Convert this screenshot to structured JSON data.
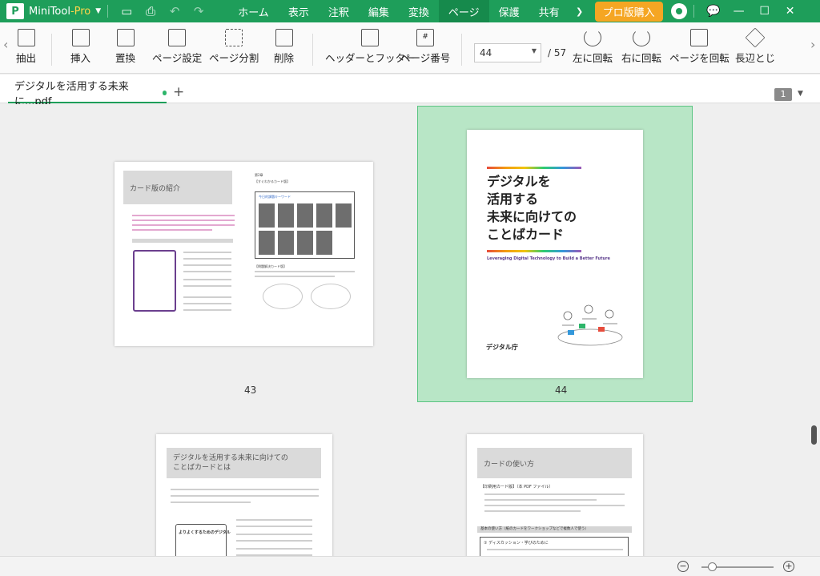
{
  "app": {
    "name": "MiniTool",
    "name_suffix": "-Pro",
    "logo_text": "P"
  },
  "menu": {
    "items": [
      {
        "label": "ホーム"
      },
      {
        "label": "表示"
      },
      {
        "label": "注釈"
      },
      {
        "label": "編集"
      },
      {
        "label": "変換"
      },
      {
        "label": "ページ",
        "active": true
      },
      {
        "label": "保護"
      },
      {
        "label": "共有"
      }
    ],
    "buy_label": "プロ版購入"
  },
  "ribbon": {
    "buttons": [
      {
        "label": "抽出",
        "icon": "extract-icon"
      },
      {
        "label": "挿入",
        "icon": "insert-page-icon"
      },
      {
        "label": "置換",
        "icon": "replace-page-icon"
      },
      {
        "label": "ページ設定",
        "icon": "page-setup-icon"
      },
      {
        "label": "ページ分割",
        "icon": "split-page-icon"
      },
      {
        "label": "削除",
        "icon": "delete-page-icon"
      },
      {
        "label": "ヘッダーとフッター",
        "icon": "header-footer-icon"
      },
      {
        "label": "ページ番号",
        "icon": "page-number-icon"
      },
      {
        "label": "左に回転",
        "icon": "rotate-left-icon"
      },
      {
        "label": "右に回転",
        "icon": "rotate-right-icon"
      },
      {
        "label": "ページを回転",
        "icon": "rotate-page-icon"
      },
      {
        "label": "長辺とじ",
        "icon": "long-edge-binding-icon"
      }
    ],
    "page_number_mark": "#",
    "current_page": "44",
    "total_pages": "/ 57"
  },
  "tabs": {
    "document_title": "デジタルを活用する未来に...pdf",
    "add_symbol": "+",
    "page_badge": "1"
  },
  "pages": {
    "left_top": {
      "number": "43",
      "heading": "カード版の紹介",
      "right_header": "第2章",
      "right_section": "【すぐわかるカード版】",
      "right_box_title": "今日的課題キーワード",
      "right_section2": "【問題解決カード版】"
    },
    "right_top": {
      "number": "44",
      "title": "デジタルを\n活用する\n未来に向けての\nことばカード",
      "subtitle": "Leveraging Digital Technology to Build a Better Future",
      "agency": "デジタル庁"
    },
    "left_bottom": {
      "heading": "デジタルを活用する未来に向けての\nことばカードとは",
      "card_title": "よりよくするためのデジタル"
    },
    "right_bottom": {
      "heading": "カードの使い方",
      "section": "【印刷用カード版】（本 PDF ファイル）",
      "band": "基本の使い方（紙のカードをワークショップなどで複数人で使う）",
      "subsection": "① ディスカッション・学びのために"
    }
  },
  "colors": {
    "brand": "#1e9e5a",
    "buy": "#f5a623",
    "selection": "#b8e6c6"
  }
}
